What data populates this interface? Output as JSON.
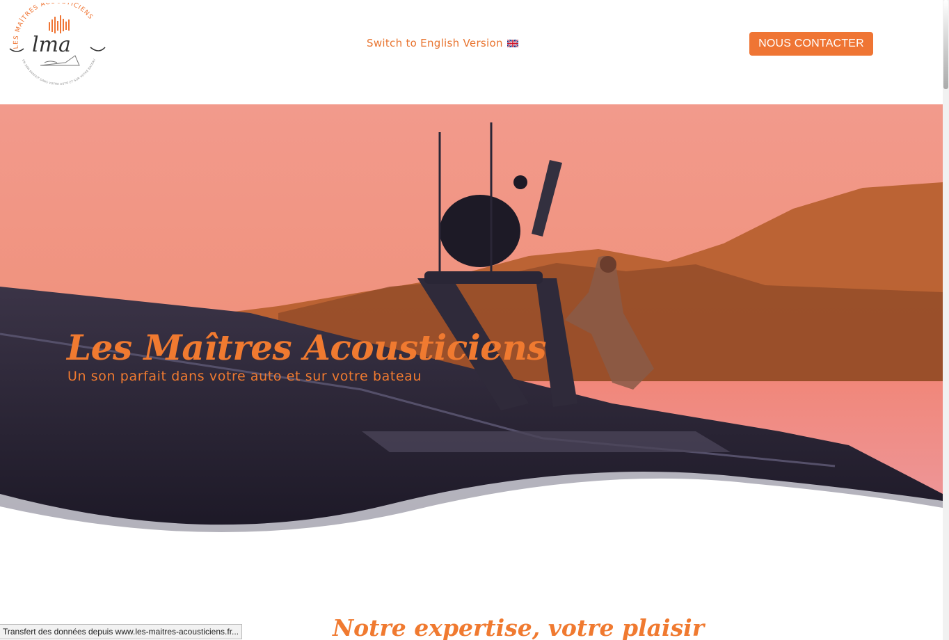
{
  "header": {
    "logo": {
      "arc_text": "LES MAÎTRES ACOUSTICIENS",
      "monogram": "lma",
      "tagline": "UN SON PARFAIT DANS VOTRE AUTO ET SUR VOTRE BATEAU"
    },
    "lang_switch_label": "Switch to English Version",
    "contact_button_label": "NOUS CONTACTER"
  },
  "hero": {
    "title": "Les Maîtres Acousticiens",
    "subtitle": "Un son parfait dans votre auto et sur votre bateau"
  },
  "section": {
    "title": "Notre expertise, votre plaisir"
  },
  "status_bar": {
    "text": "Transfert des données depuis www.les-maitres-acousticiens.fr..."
  },
  "colors": {
    "accent": "#ef7534",
    "hero_sky": "#f29a88",
    "mountain": "#b05a2e",
    "boat_hull": "#2a2536"
  },
  "icons": {
    "flag": "uk-flag-icon",
    "logo": "lma-logo-icon"
  }
}
